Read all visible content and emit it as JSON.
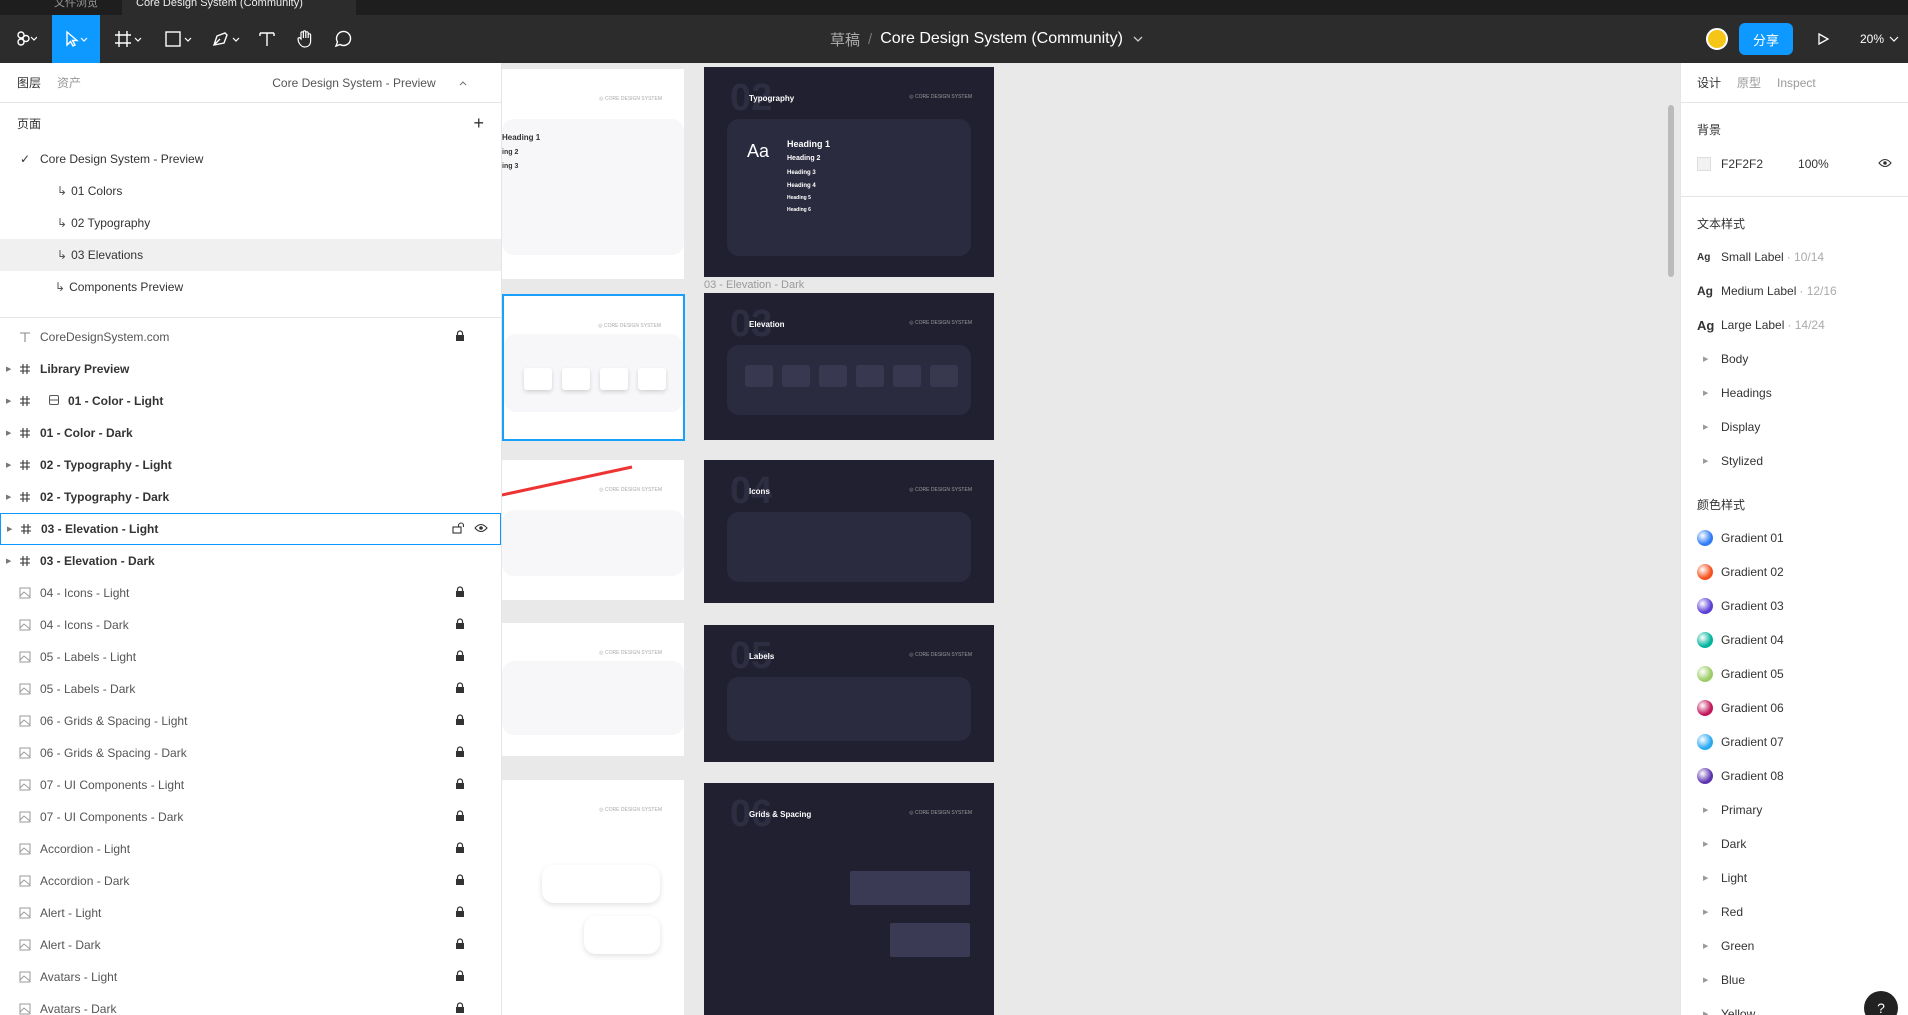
{
  "window": {
    "tabs": [
      {
        "label": "文件浏览"
      },
      {
        "label": "Core Design System (Community)"
      }
    ]
  },
  "toolbar": {
    "breadcrumb_draft": "草稿",
    "breadcrumb_sep": "/",
    "file_name": "Core Design System (Community)",
    "share_label": "分享",
    "zoom": "20%"
  },
  "left_panel": {
    "tabs": {
      "layers": "图层",
      "assets": "资产"
    },
    "page_selector": "Core Design System - Preview",
    "pages_title": "页面",
    "add_page": "+",
    "pages": [
      {
        "label": "Core Design System - Preview",
        "selected_check": true
      },
      {
        "label": "01 Colors"
      },
      {
        "label": "02 Typography"
      },
      {
        "label": "03 Elevations"
      },
      {
        "label": "Components Preview"
      }
    ],
    "layers": [
      {
        "label": "CoreDesignSystem.com",
        "icon": "text-icon",
        "locked": true,
        "bold": false
      },
      {
        "label": "Library Preview",
        "icon": "frame-icon",
        "bold": true
      },
      {
        "label": "01 - Color - Light",
        "icon": "frame-icon",
        "bold": true,
        "extra_icon": "component-set-icon"
      },
      {
        "label": "01 - Color - Dark",
        "icon": "frame-icon",
        "bold": true
      },
      {
        "label": "02 - Typography - Light",
        "icon": "frame-icon",
        "bold": true
      },
      {
        "label": "02 - Typography - Dark",
        "icon": "frame-icon",
        "bold": true
      },
      {
        "label": "03 - Elevation - Light",
        "icon": "frame-icon",
        "bold": true,
        "highlighted": true
      },
      {
        "label": "03 - Elevation - Dark",
        "icon": "frame-icon",
        "bold": true
      },
      {
        "label": "04 - Icons - Light",
        "icon": "image-icon",
        "locked": true
      },
      {
        "label": "04 - Icons - Dark",
        "icon": "image-icon",
        "locked": true
      },
      {
        "label": "05 - Labels - Light",
        "icon": "image-icon",
        "locked": true
      },
      {
        "label": "05 - Labels - Dark",
        "icon": "image-icon",
        "locked": true
      },
      {
        "label": "06 - Grids & Spacing - Light",
        "icon": "image-icon",
        "locked": true
      },
      {
        "label": "06 - Grids & Spacing - Dark",
        "icon": "image-icon",
        "locked": true
      },
      {
        "label": "07 - UI Components - Light",
        "icon": "image-icon",
        "locked": true
      },
      {
        "label": "07 - UI Components - Dark",
        "icon": "image-icon",
        "locked": true
      },
      {
        "label": "Accordion - Light",
        "icon": "image-icon",
        "locked": true
      },
      {
        "label": "Accordion - Dark",
        "icon": "image-icon",
        "locked": true
      },
      {
        "label": "Alert - Light",
        "icon": "image-icon",
        "locked": true
      },
      {
        "label": "Alert - Dark",
        "icon": "image-icon",
        "locked": true
      },
      {
        "label": "Avatars - Light",
        "icon": "image-icon",
        "locked": true
      },
      {
        "label": "Avatars - Dark",
        "icon": "image-icon",
        "locked": true
      }
    ]
  },
  "canvas": {
    "frame_label": "03 - Elevation - Dark",
    "brand": "◎ CORE DESIGN SYSTEM",
    "frames": [
      {
        "num": "02",
        "title": "Typography",
        "headings": [
          "Heading 1",
          "Heading 2",
          "Heading 3",
          "Heading 4",
          "Heading 5",
          "Heading 6"
        ],
        "aa": "Aa"
      },
      {
        "num": "03",
        "title": "Elevation"
      },
      {
        "num": "04",
        "title": "Icons"
      },
      {
        "num": "05",
        "title": "Labels"
      },
      {
        "num": "06",
        "title": "Grids & Spacing"
      }
    ],
    "light_headings": [
      "Heading 1",
      "ing 2",
      "ing 3"
    ]
  },
  "right_panel": {
    "tabs": {
      "design": "设计",
      "prototype": "原型",
      "inspect": "Inspect"
    },
    "background_title": "背景",
    "background_hex": "F2F2F2",
    "background_opacity": "100%",
    "text_styles_title": "文本样式",
    "text_styles": [
      {
        "ag": "Ag",
        "name": "Small Label",
        "meta": "· 10/14"
      },
      {
        "ag": "Ag",
        "name": "Medium Label",
        "meta": "· 12/16"
      },
      {
        "ag": "Ag",
        "name": "Large Label",
        "meta": "· 14/24"
      }
    ],
    "text_groups": [
      "Body",
      "Headings",
      "Display",
      "Stylized"
    ],
    "color_styles_title": "颜色样式",
    "gradients": [
      {
        "name": "Gradient 01",
        "color": "#2f7cf6"
      },
      {
        "name": "Gradient 02",
        "color": "#f4511e"
      },
      {
        "name": "Gradient 03",
        "color": "#5b3fd6"
      },
      {
        "name": "Gradient 04",
        "color": "#00b49c"
      },
      {
        "name": "Gradient 05",
        "color": "#9ccc65"
      },
      {
        "name": "Gradient 06",
        "color": "#c2185b"
      },
      {
        "name": "Gradient 07",
        "color": "#29a8f2"
      },
      {
        "name": "Gradient 08",
        "color": "#5e35b1"
      }
    ],
    "color_groups": [
      "Primary",
      "Dark",
      "Light",
      "Red",
      "Green",
      "Blue",
      "Yellow"
    ],
    "help": "?"
  }
}
